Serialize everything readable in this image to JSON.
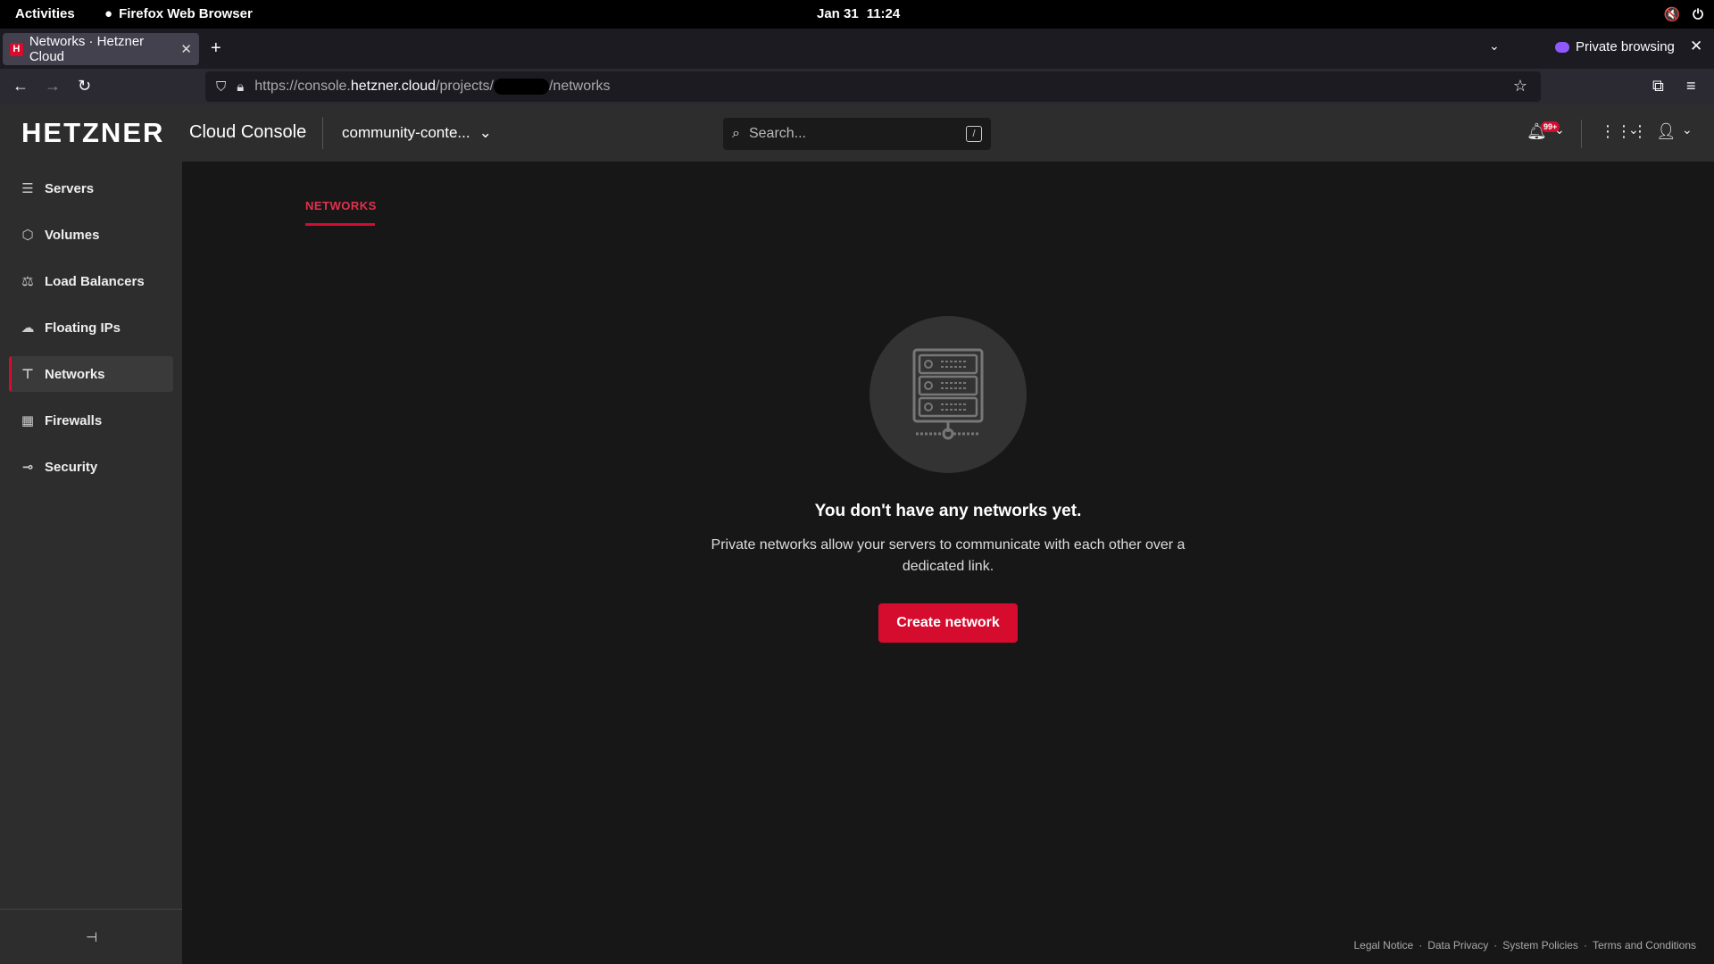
{
  "os_bar": {
    "activities": "Activities",
    "app_name": "Firefox Web Browser",
    "date": "Jan 31",
    "time": "11:24"
  },
  "browser": {
    "tab_title": "Networks · Hetzner Cloud",
    "private_label": "Private browsing",
    "url_prefix": "https://console.",
    "url_host": "hetzner.cloud",
    "url_path_1": "/projects/",
    "url_path_2": "/networks"
  },
  "header": {
    "logo": "HETZNER",
    "product": "Cloud Console",
    "project": "community-conte...",
    "search_placeholder": "Search...",
    "search_shortcut": "/",
    "notification_count": "99+"
  },
  "sidebar": {
    "items": [
      {
        "label": "Servers",
        "icon": "server-icon"
      },
      {
        "label": "Volumes",
        "icon": "cube-icon"
      },
      {
        "label": "Load Balancers",
        "icon": "load-balancer-icon"
      },
      {
        "label": "Floating IPs",
        "icon": "floating-ip-icon"
      },
      {
        "label": "Networks",
        "icon": "network-icon",
        "active": true
      },
      {
        "label": "Firewalls",
        "icon": "firewall-icon"
      },
      {
        "label": "Security",
        "icon": "key-icon"
      }
    ]
  },
  "main": {
    "tab": "NETWORKS",
    "empty_title": "You don't have any networks yet.",
    "empty_desc": "Private networks allow your servers to communicate with each other over a dedicated link.",
    "create_button": "Create network"
  },
  "footer": {
    "links": [
      "Legal Notice",
      "Data Privacy",
      "System Policies",
      "Terms and Conditions"
    ]
  },
  "colors": {
    "accent": "#d50c2d",
    "sidebar_bg": "#2d2d2d",
    "main_bg": "#171717"
  }
}
